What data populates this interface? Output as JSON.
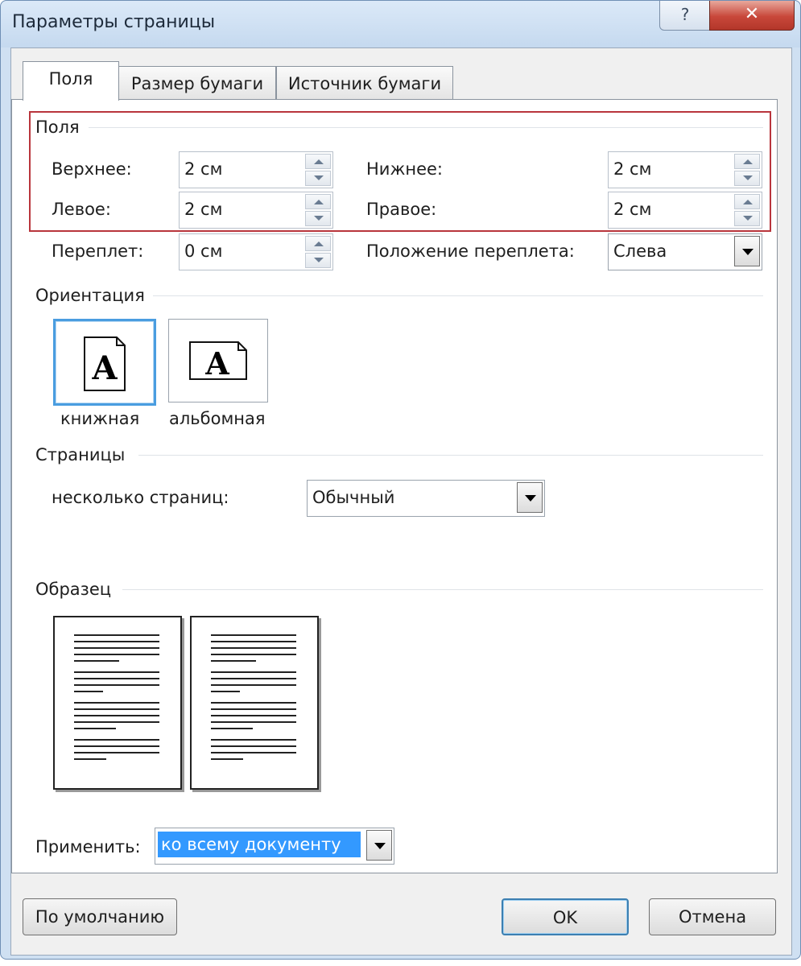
{
  "window": {
    "title": "Параметры страницы",
    "help_label": "?",
    "close_label": "✕"
  },
  "tabs": [
    {
      "label": "Поля",
      "active": true
    },
    {
      "label": "Размер бумаги",
      "active": false
    },
    {
      "label": "Источник бумаги",
      "active": false
    }
  ],
  "margins": {
    "group_label": "Поля",
    "top": {
      "label": "Верхнее:",
      "value": "2 см"
    },
    "bottom": {
      "label": "Нижнее:",
      "value": "2 см"
    },
    "left": {
      "label": "Левое:",
      "value": "2 см"
    },
    "right": {
      "label": "Правое:",
      "value": "2 см"
    },
    "gutter": {
      "label": "Переплет:",
      "value": "0 см"
    },
    "gutter_position": {
      "label": "Положение переплета:",
      "value": "Слева"
    }
  },
  "orientation": {
    "group_label": "Ориентация",
    "portrait_label": "книжная",
    "landscape_label": "альбомная",
    "glyph": "A",
    "selected": "portrait"
  },
  "pages": {
    "group_label": "Страницы",
    "multiple_label": "несколько страниц:",
    "multiple_value": "Обычный"
  },
  "preview": {
    "group_label": "Образец"
  },
  "apply": {
    "label": "Применить:",
    "value": "ко всему документу"
  },
  "buttons": {
    "default": "По умолчанию",
    "ok": "OK",
    "cancel": "Отмена"
  },
  "colors": {
    "highlight_box": "#b9353c",
    "selection": "#3399ff",
    "accent": "#4a9de0"
  }
}
